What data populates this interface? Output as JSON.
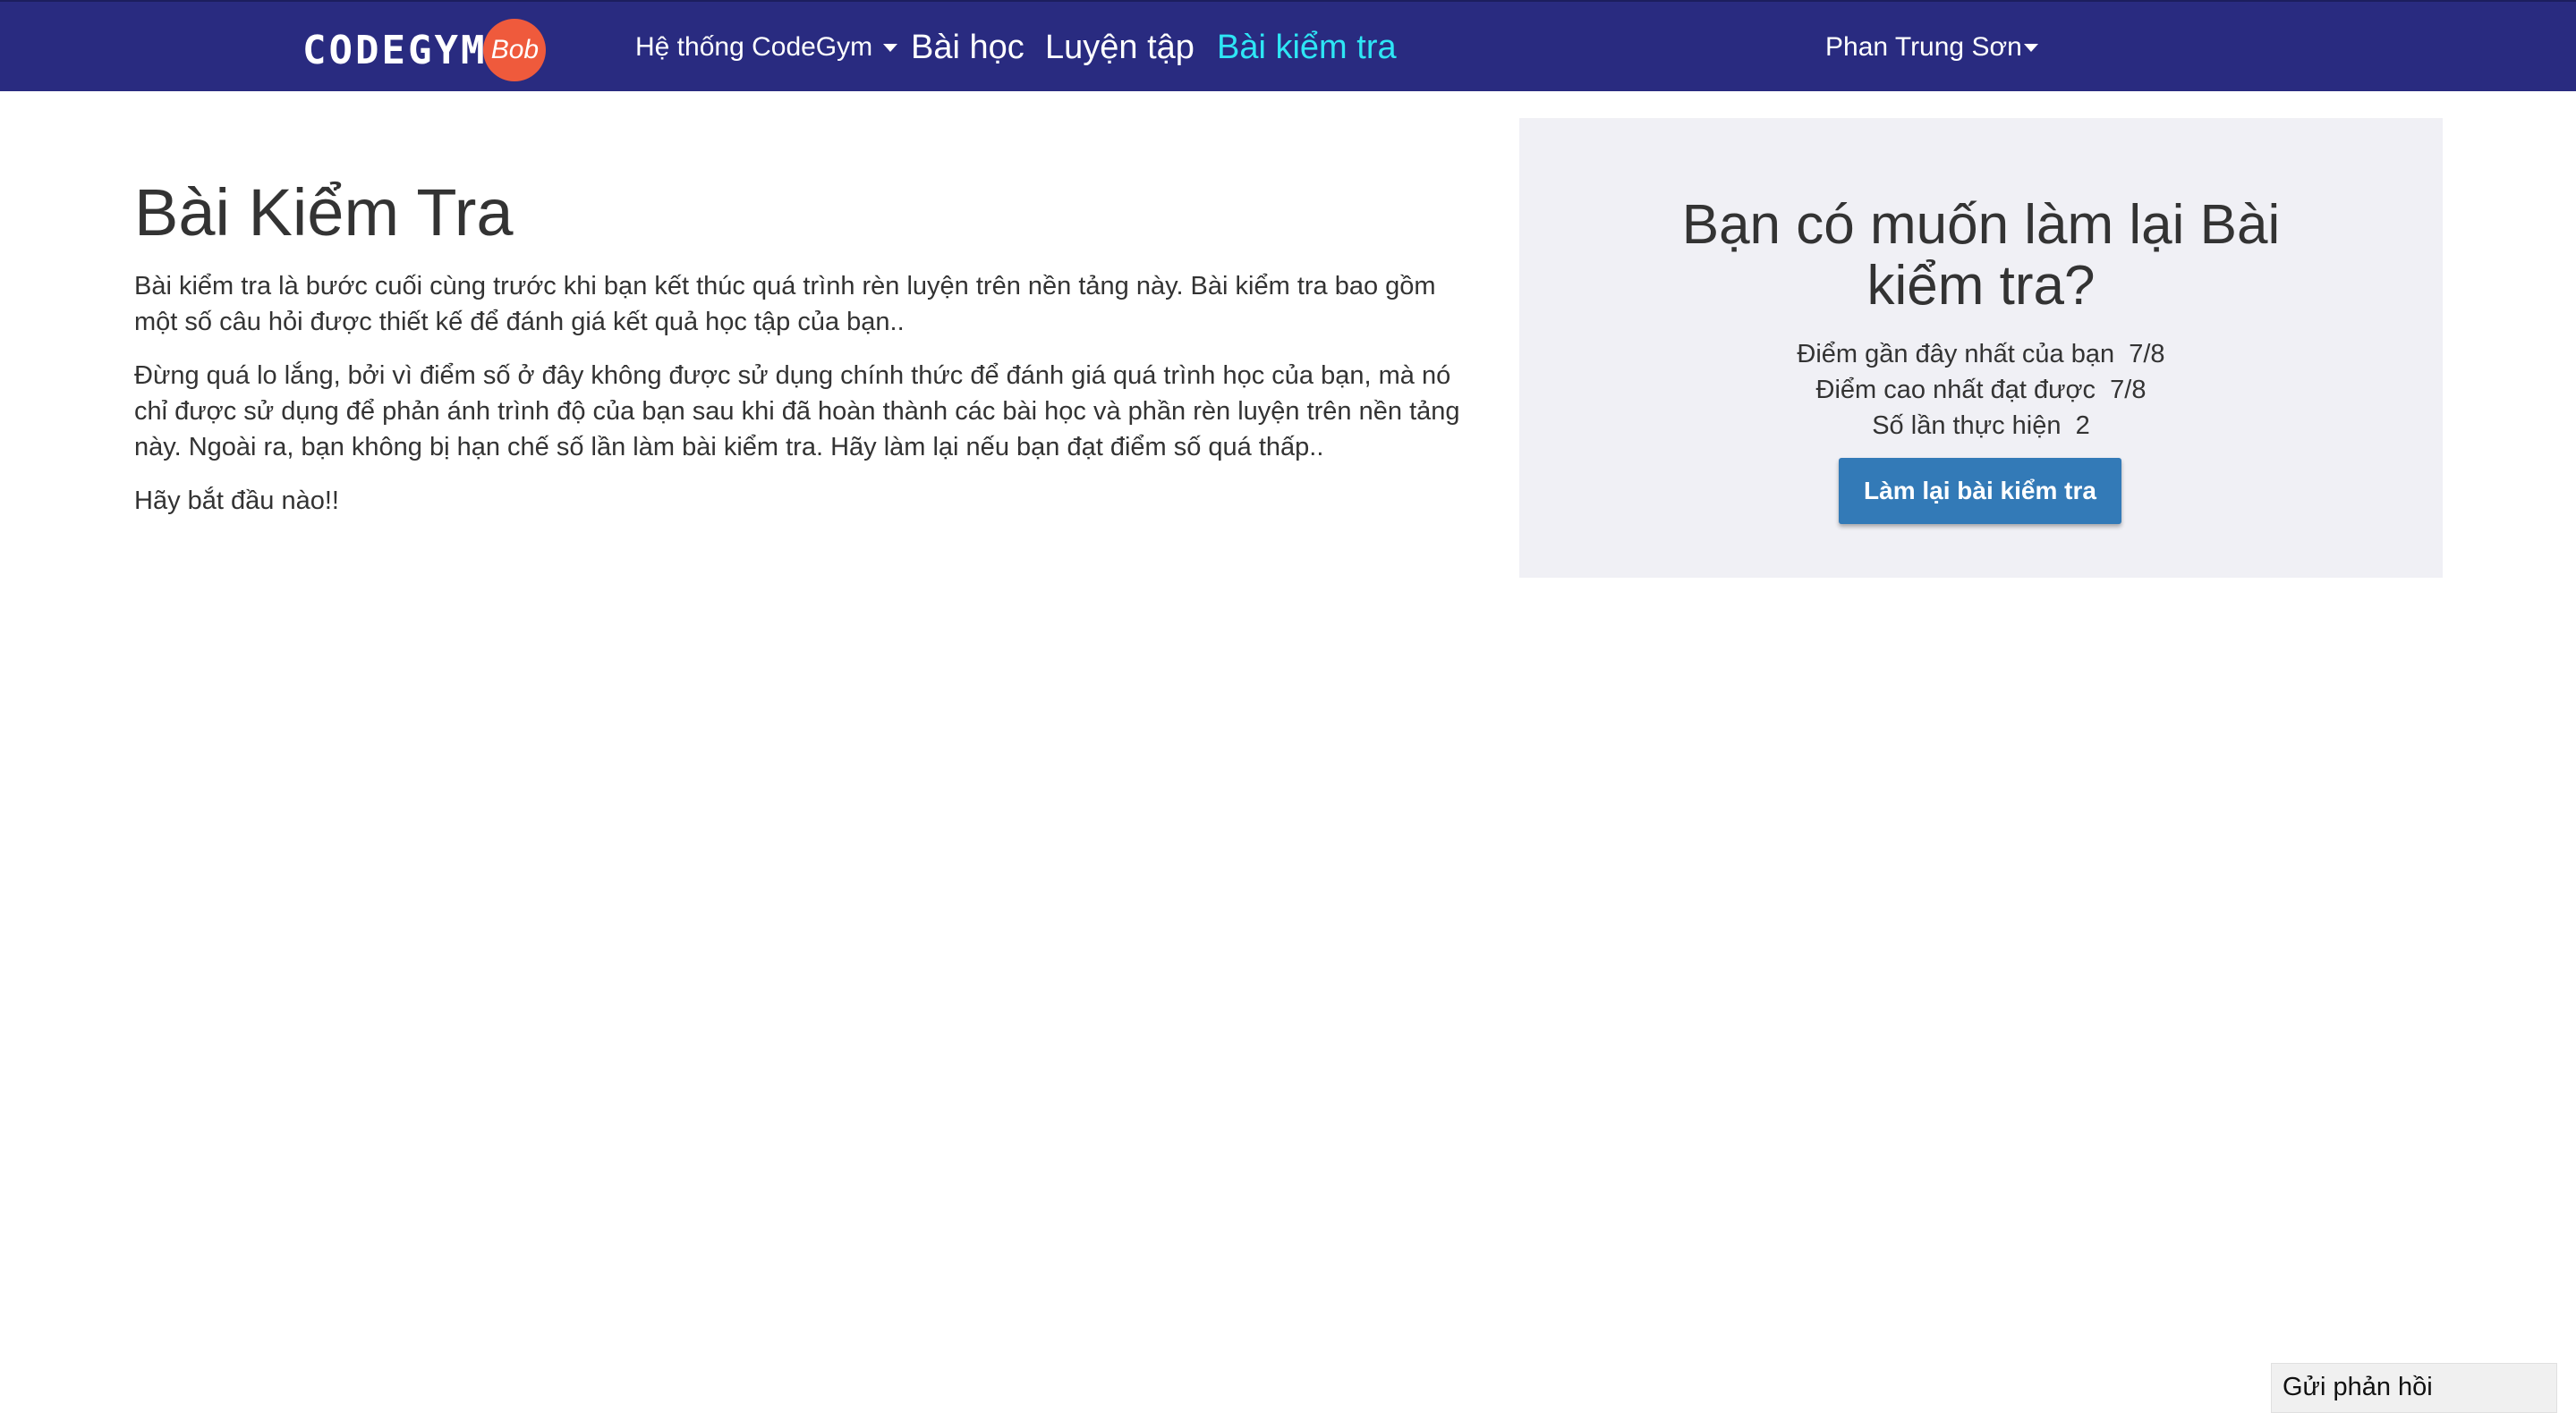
{
  "navbar": {
    "brand_text": "CODEGYM",
    "brand_badge": "Bob",
    "system_menu_label": "Hệ thống CodeGym",
    "lessons_label": "Bài học",
    "practice_label": "Luyện tập",
    "tests_label": "Bài kiểm tra",
    "user_menu_label": "Phan Trung Sơn",
    "background_color": "#292b80",
    "active_color": "#2ee6f5"
  },
  "main": {
    "title": "Bài Kiểm Tra",
    "paragraphs": [
      "Bài kiểm tra là bước cuối cùng trước khi bạn kết thúc quá trình rèn luyện trên nền tảng này. Bài kiểm tra bao gồm một số câu hỏi được thiết kế để đánh giá kết quả học tập của bạn..",
      "Đừng quá lo lắng, bởi vì điểm số ở đây không được sử dụng chính thức để đánh giá quá trình học của bạn, mà nó chỉ được sử dụng để phản ánh trình độ của bạn sau khi đã hoàn thành các bài học và phần rèn luyện trên nền tảng này. Ngoài ra, bạn không bị hạn chế số lần làm bài kiểm tra. Hãy làm lại nếu bạn đạt điểm số quá thấp..",
      "Hãy bắt đầu nào!!"
    ]
  },
  "retry_panel": {
    "title": "Bạn có muốn làm lại Bài kiểm tra?",
    "latest_score_label": "Điểm gần đây nhất của bạn",
    "latest_score_value": "7/8",
    "best_score_label": "Điểm cao nhất đạt được",
    "best_score_value": "7/8",
    "attempts_label": "Số lần thực hiện",
    "attempts_value": "2",
    "button_label": "Làm lại bài kiểm tra",
    "background_color": "#f0f0f5",
    "button_color": "#337ab7"
  },
  "feedback": {
    "label": "Gửi phản hồi"
  }
}
